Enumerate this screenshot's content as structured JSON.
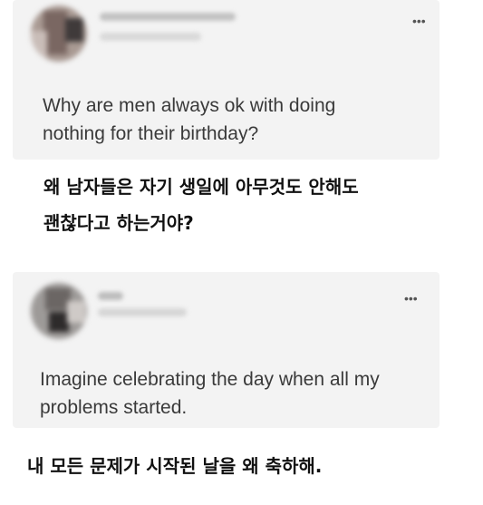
{
  "posts": [
    {
      "more_icon": "more-horizontal-icon",
      "more_glyph": "•••",
      "text": "Why are men always ok with doing\nnothing for their birthday?",
      "translation": "왜 남자들은 자기 생일에 아무것도 안해도\n괜찮다고 하는거야?"
    },
    {
      "more_icon": "more-horizontal-icon",
      "more_glyph": "•••",
      "text": "Imagine celebrating the day when all my\nproblems started.",
      "translation": "내 모든 문제가 시작된 날을 왜 축하해."
    }
  ]
}
